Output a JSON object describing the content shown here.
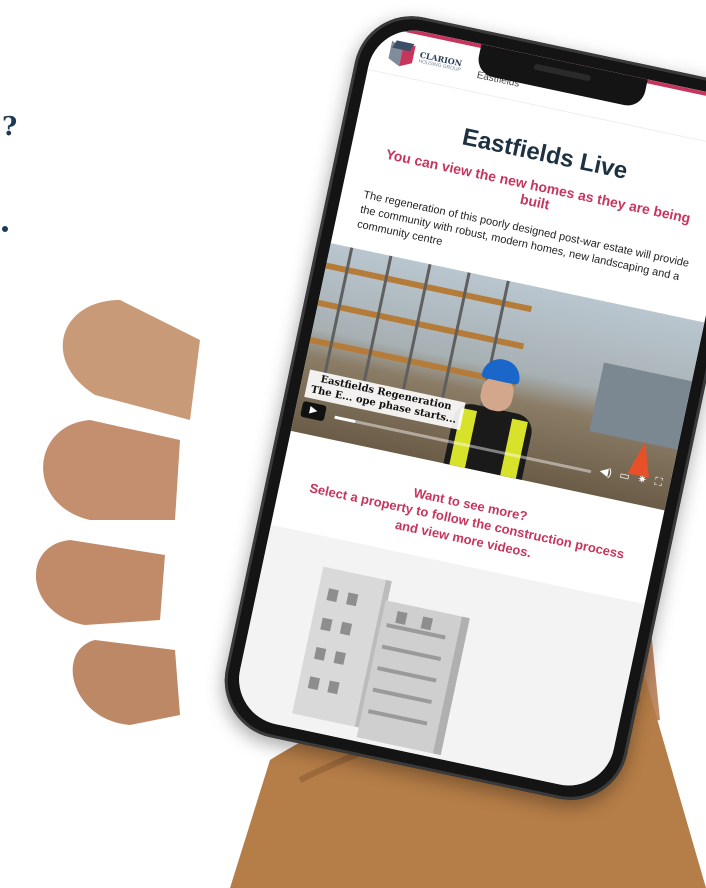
{
  "background_edge": {
    "question_mark": "?"
  },
  "site": {
    "logo_text": "CLARION",
    "logo_sub": "HOUSING GROUP",
    "breadcrumb": "Eastfields"
  },
  "page": {
    "title": "Eastfields Live",
    "subtitle": "You can view the new homes as they are being built",
    "intro": "The regeneration of this poorly designed post-war estate will provide the community with robust, modern homes, new landscaping and a community centre"
  },
  "video": {
    "caption_line1": "Eastfields Regeneration",
    "caption_line2": "The E... ope phase starts...",
    "progress": 0.08,
    "controls": [
      "volume-icon",
      "captions-icon",
      "settings-icon",
      "fullscreen-icon"
    ]
  },
  "more": {
    "line1": "Want to see more?",
    "line2": "Select a property to follow the construction process",
    "line3": "and view more videos."
  },
  "colors": {
    "accent": "#c7355d",
    "title": "#1c3142",
    "brand_navy": "#2b3f5a"
  }
}
